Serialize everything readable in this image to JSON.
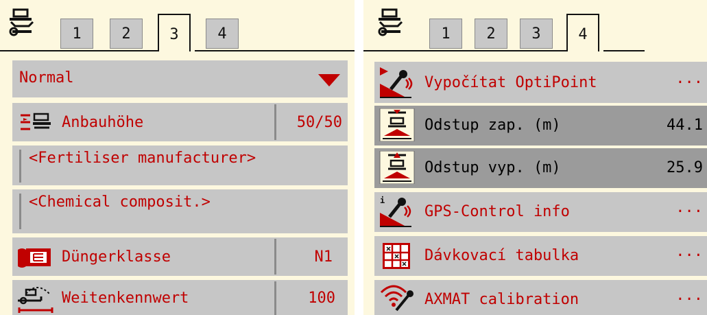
{
  "left_panel": {
    "tabs": [
      "1",
      "2",
      "3",
      "4"
    ],
    "active_tab": "3",
    "dropdown": {
      "value": "Normal"
    },
    "rows": [
      {
        "label": "Anbauhöhe",
        "value": "50/50",
        "icon": "mounting-height-icon"
      },
      {
        "label": "<Fertiliser manufacturer>",
        "icon": "text-cursor"
      },
      {
        "label": "<Chemical composit.>",
        "icon": "text-cursor"
      },
      {
        "label": "Düngerklasse",
        "value": "N1",
        "icon": "fertiliser-bag-icon"
      },
      {
        "label": "Weitenkennwert",
        "value": "100",
        "icon": "spreading-width-icon"
      }
    ]
  },
  "right_panel": {
    "tabs": [
      "1",
      "2",
      "3",
      "4"
    ],
    "active_tab": "4",
    "rows": [
      {
        "label": "Vypočítat OptiPoint",
        "value": "···",
        "icon": "optipoint-icon",
        "selected": false
      },
      {
        "label": "Odstup zap. (m)",
        "value": "44.1",
        "icon": "distance-on-icon",
        "selected": true
      },
      {
        "label": "Odstup vyp. (m)",
        "value": "25.9",
        "icon": "distance-off-icon",
        "selected": true
      },
      {
        "label": "GPS-Control info",
        "value": "···",
        "icon": "gps-info-icon",
        "selected": false
      },
      {
        "label": "Dávkovací tabulka",
        "value": "···",
        "icon": "dosing-table-icon",
        "selected": false
      },
      {
        "label": "AXMAT calibration",
        "value": "···",
        "icon": "axmat-wifi-icon",
        "selected": false
      }
    ]
  },
  "colors": {
    "panel_bg": "#fdf8df",
    "row_bg": "#c6c6c6",
    "row_selected_bg": "#9b9b9b",
    "text_red": "#c00000"
  }
}
